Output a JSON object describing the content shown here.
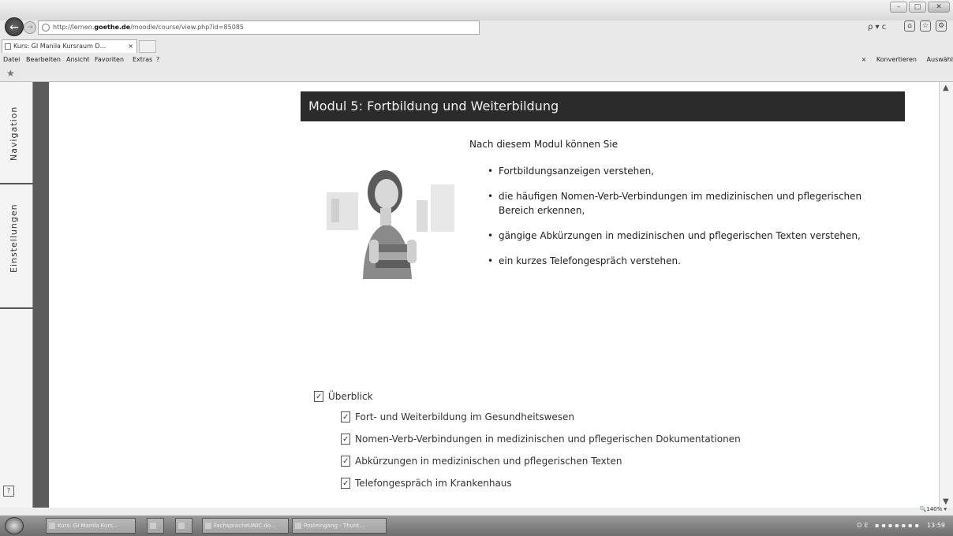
{
  "browser": {
    "url_prefix": "http://lernen.",
    "url_host": "goethe.de",
    "url_path": "/moodle/course/view.php?id=85085",
    "search_refresh": "ρ ▾ c",
    "tab_title": "Kurs: GI Manila Kursraum D...",
    "tab_close": "×",
    "menu": [
      "Datei",
      "Bearbeiten",
      "Ansicht",
      "Favoriten",
      "Extras",
      "?"
    ],
    "menu_right_close": "×",
    "menu_right_convert": "Konvertieren",
    "menu_right_select": "Auswähl"
  },
  "sidebar": {
    "tabs": [
      "Navigation",
      "Einstellungen"
    ],
    "help": "?"
  },
  "module": {
    "title": "Modul 5: Fortbildung und Weiterbildung",
    "intro": "Nach diesem Modul können Sie",
    "goals": [
      "Fortbildungsanzeigen verstehen,",
      "die häufigen Nomen-Verb-Verbindungen im medizinischen und pflegerischen Bereich erkennen,",
      "gängige Abkürzungen in medizinischen und pflegerischen Texten verstehen,",
      "ein kurzes Telefongespräch verstehen."
    ]
  },
  "resources": {
    "overview": "Überblick",
    "items": [
      "Fort- und Weiterbildung im Gesundheitswesen",
      "Nomen-Verb-Verbindungen in medizinischen und pflegerischen Dokumentationen",
      "Abkürzungen in medizinischen und pflegerischen Texten",
      "Telefongespräch im Krankenhaus"
    ]
  },
  "statusbar": {
    "zoom": "140%"
  },
  "taskbar": {
    "items": [
      "Kurs: GI Manila Kurs...",
      "FachspracheUNIC.do...",
      "Posteingang - Thunt..."
    ],
    "tray": "DE",
    "clock": "13:59"
  },
  "colors": {
    "header_bg": "#2b2b2b",
    "header_text": "#f2f2f2",
    "sidebar_strip": "#5b5b5b"
  }
}
